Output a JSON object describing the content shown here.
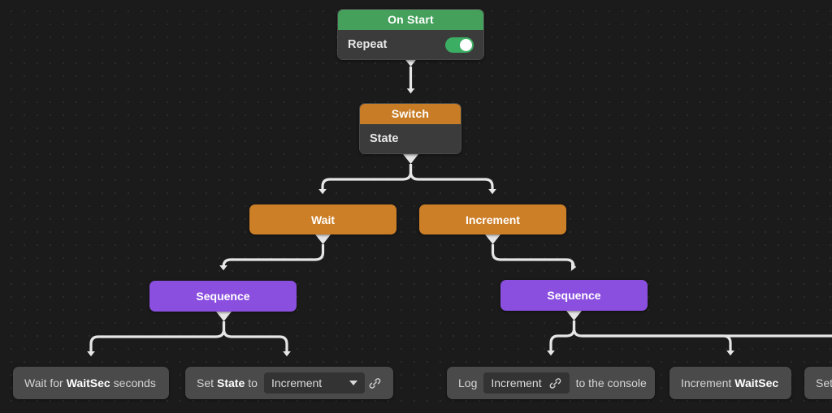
{
  "canvas": {
    "background_color": "#1b1b1b",
    "grid_dot_color": "#2b2b2b",
    "edge_color": "#e6e6e6"
  },
  "nodes": {
    "on_start": {
      "title": "On Start",
      "header_color": "#44a05a",
      "field_label": "Repeat",
      "toggle_state": "on"
    },
    "switch": {
      "title": "Switch",
      "header_color": "#c77c25",
      "field_label": "State"
    },
    "wait": {
      "title": "Wait",
      "color": "#cd7f28"
    },
    "increment": {
      "title": "Increment",
      "color": "#cd7f28"
    },
    "sequence_left": {
      "title": "Sequence",
      "color": "#8b4fe0"
    },
    "sequence_right": {
      "title": "Sequence",
      "color": "#8b4fe0"
    },
    "wait_for": {
      "text_before": "Wait for",
      "variable": "WaitSec",
      "text_after": "seconds"
    },
    "set_state": {
      "text_before": "Set",
      "variable": "State",
      "text_mid": "to",
      "dropdown_value": "Increment",
      "link_icon": "link-icon"
    },
    "log": {
      "text_before": "Log",
      "chip_value": "Increment",
      "link_icon": "link-icon",
      "text_after": "to the console"
    },
    "increment_waitsec": {
      "text_before": "Increment",
      "variable": "WaitSec"
    },
    "set_cutoff": {
      "text": "Set"
    }
  }
}
